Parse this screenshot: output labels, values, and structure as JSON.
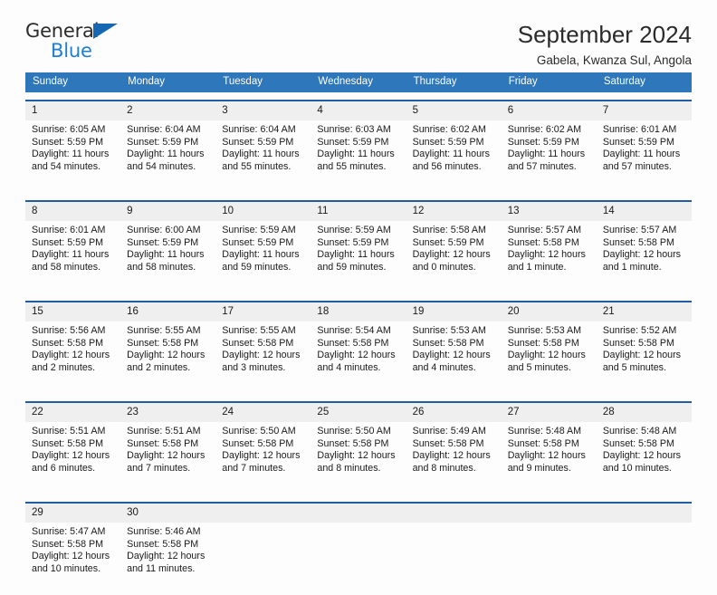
{
  "logo": {
    "word_top": "General",
    "word_bottom": "Blue",
    "triangle_color": "#1668b3",
    "blue_color": "#1f7fd0"
  },
  "header": {
    "title": "September 2024",
    "subtitle": "Gabela, Kwanza Sul, Angola"
  },
  "colors": {
    "header_row_bg": "#2e77bb",
    "week_separator": "#1f5fa0",
    "day_number_bg": "#efefef",
    "page_bg": "#fdfdfd",
    "text": "#1a1a1a"
  },
  "labels": {
    "sunrise": "Sunrise:",
    "sunset": "Sunset:",
    "daylight": "Daylight:"
  },
  "weekdays": [
    "Sunday",
    "Monday",
    "Tuesday",
    "Wednesday",
    "Thursday",
    "Friday",
    "Saturday"
  ],
  "weeks": [
    [
      {
        "day": "1",
        "sunrise": "Sunrise: 6:05 AM",
        "sunset": "Sunset: 5:59 PM",
        "daylight_line1": "Daylight: 11 hours",
        "daylight_line2": "and 54 minutes."
      },
      {
        "day": "2",
        "sunrise": "Sunrise: 6:04 AM",
        "sunset": "Sunset: 5:59 PM",
        "daylight_line1": "Daylight: 11 hours",
        "daylight_line2": "and 54 minutes."
      },
      {
        "day": "3",
        "sunrise": "Sunrise: 6:04 AM",
        "sunset": "Sunset: 5:59 PM",
        "daylight_line1": "Daylight: 11 hours",
        "daylight_line2": "and 55 minutes."
      },
      {
        "day": "4",
        "sunrise": "Sunrise: 6:03 AM",
        "sunset": "Sunset: 5:59 PM",
        "daylight_line1": "Daylight: 11 hours",
        "daylight_line2": "and 55 minutes."
      },
      {
        "day": "5",
        "sunrise": "Sunrise: 6:02 AM",
        "sunset": "Sunset: 5:59 PM",
        "daylight_line1": "Daylight: 11 hours",
        "daylight_line2": "and 56 minutes."
      },
      {
        "day": "6",
        "sunrise": "Sunrise: 6:02 AM",
        "sunset": "Sunset: 5:59 PM",
        "daylight_line1": "Daylight: 11 hours",
        "daylight_line2": "and 57 minutes."
      },
      {
        "day": "7",
        "sunrise": "Sunrise: 6:01 AM",
        "sunset": "Sunset: 5:59 PM",
        "daylight_line1": "Daylight: 11 hours",
        "daylight_line2": "and 57 minutes."
      }
    ],
    [
      {
        "day": "8",
        "sunrise": "Sunrise: 6:01 AM",
        "sunset": "Sunset: 5:59 PM",
        "daylight_line1": "Daylight: 11 hours",
        "daylight_line2": "and 58 minutes."
      },
      {
        "day": "9",
        "sunrise": "Sunrise: 6:00 AM",
        "sunset": "Sunset: 5:59 PM",
        "daylight_line1": "Daylight: 11 hours",
        "daylight_line2": "and 58 minutes."
      },
      {
        "day": "10",
        "sunrise": "Sunrise: 5:59 AM",
        "sunset": "Sunset: 5:59 PM",
        "daylight_line1": "Daylight: 11 hours",
        "daylight_line2": "and 59 minutes."
      },
      {
        "day": "11",
        "sunrise": "Sunrise: 5:59 AM",
        "sunset": "Sunset: 5:59 PM",
        "daylight_line1": "Daylight: 11 hours",
        "daylight_line2": "and 59 minutes."
      },
      {
        "day": "12",
        "sunrise": "Sunrise: 5:58 AM",
        "sunset": "Sunset: 5:59 PM",
        "daylight_line1": "Daylight: 12 hours",
        "daylight_line2": "and 0 minutes."
      },
      {
        "day": "13",
        "sunrise": "Sunrise: 5:57 AM",
        "sunset": "Sunset: 5:58 PM",
        "daylight_line1": "Daylight: 12 hours",
        "daylight_line2": "and 1 minute."
      },
      {
        "day": "14",
        "sunrise": "Sunrise: 5:57 AM",
        "sunset": "Sunset: 5:58 PM",
        "daylight_line1": "Daylight: 12 hours",
        "daylight_line2": "and 1 minute."
      }
    ],
    [
      {
        "day": "15",
        "sunrise": "Sunrise: 5:56 AM",
        "sunset": "Sunset: 5:58 PM",
        "daylight_line1": "Daylight: 12 hours",
        "daylight_line2": "and 2 minutes."
      },
      {
        "day": "16",
        "sunrise": "Sunrise: 5:55 AM",
        "sunset": "Sunset: 5:58 PM",
        "daylight_line1": "Daylight: 12 hours",
        "daylight_line2": "and 2 minutes."
      },
      {
        "day": "17",
        "sunrise": "Sunrise: 5:55 AM",
        "sunset": "Sunset: 5:58 PM",
        "daylight_line1": "Daylight: 12 hours",
        "daylight_line2": "and 3 minutes."
      },
      {
        "day": "18",
        "sunrise": "Sunrise: 5:54 AM",
        "sunset": "Sunset: 5:58 PM",
        "daylight_line1": "Daylight: 12 hours",
        "daylight_line2": "and 4 minutes."
      },
      {
        "day": "19",
        "sunrise": "Sunrise: 5:53 AM",
        "sunset": "Sunset: 5:58 PM",
        "daylight_line1": "Daylight: 12 hours",
        "daylight_line2": "and 4 minutes."
      },
      {
        "day": "20",
        "sunrise": "Sunrise: 5:53 AM",
        "sunset": "Sunset: 5:58 PM",
        "daylight_line1": "Daylight: 12 hours",
        "daylight_line2": "and 5 minutes."
      },
      {
        "day": "21",
        "sunrise": "Sunrise: 5:52 AM",
        "sunset": "Sunset: 5:58 PM",
        "daylight_line1": "Daylight: 12 hours",
        "daylight_line2": "and 5 minutes."
      }
    ],
    [
      {
        "day": "22",
        "sunrise": "Sunrise: 5:51 AM",
        "sunset": "Sunset: 5:58 PM",
        "daylight_line1": "Daylight: 12 hours",
        "daylight_line2": "and 6 minutes."
      },
      {
        "day": "23",
        "sunrise": "Sunrise: 5:51 AM",
        "sunset": "Sunset: 5:58 PM",
        "daylight_line1": "Daylight: 12 hours",
        "daylight_line2": "and 7 minutes."
      },
      {
        "day": "24",
        "sunrise": "Sunrise: 5:50 AM",
        "sunset": "Sunset: 5:58 PM",
        "daylight_line1": "Daylight: 12 hours",
        "daylight_line2": "and 7 minutes."
      },
      {
        "day": "25",
        "sunrise": "Sunrise: 5:50 AM",
        "sunset": "Sunset: 5:58 PM",
        "daylight_line1": "Daylight: 12 hours",
        "daylight_line2": "and 8 minutes."
      },
      {
        "day": "26",
        "sunrise": "Sunrise: 5:49 AM",
        "sunset": "Sunset: 5:58 PM",
        "daylight_line1": "Daylight: 12 hours",
        "daylight_line2": "and 8 minutes."
      },
      {
        "day": "27",
        "sunrise": "Sunrise: 5:48 AM",
        "sunset": "Sunset: 5:58 PM",
        "daylight_line1": "Daylight: 12 hours",
        "daylight_line2": "and 9 minutes."
      },
      {
        "day": "28",
        "sunrise": "Sunrise: 5:48 AM",
        "sunset": "Sunset: 5:58 PM",
        "daylight_line1": "Daylight: 12 hours",
        "daylight_line2": "and 10 minutes."
      }
    ],
    [
      {
        "day": "29",
        "sunrise": "Sunrise: 5:47 AM",
        "sunset": "Sunset: 5:58 PM",
        "daylight_line1": "Daylight: 12 hours",
        "daylight_line2": "and 10 minutes."
      },
      {
        "day": "30",
        "sunrise": "Sunrise: 5:46 AM",
        "sunset": "Sunset: 5:58 PM",
        "daylight_line1": "Daylight: 12 hours",
        "daylight_line2": "and 11 minutes."
      },
      {
        "day": "",
        "sunrise": "",
        "sunset": "",
        "daylight_line1": "",
        "daylight_line2": ""
      },
      {
        "day": "",
        "sunrise": "",
        "sunset": "",
        "daylight_line1": "",
        "daylight_line2": ""
      },
      {
        "day": "",
        "sunrise": "",
        "sunset": "",
        "daylight_line1": "",
        "daylight_line2": ""
      },
      {
        "day": "",
        "sunrise": "",
        "sunset": "",
        "daylight_line1": "",
        "daylight_line2": ""
      },
      {
        "day": "",
        "sunrise": "",
        "sunset": "",
        "daylight_line1": "",
        "daylight_line2": ""
      }
    ]
  ]
}
